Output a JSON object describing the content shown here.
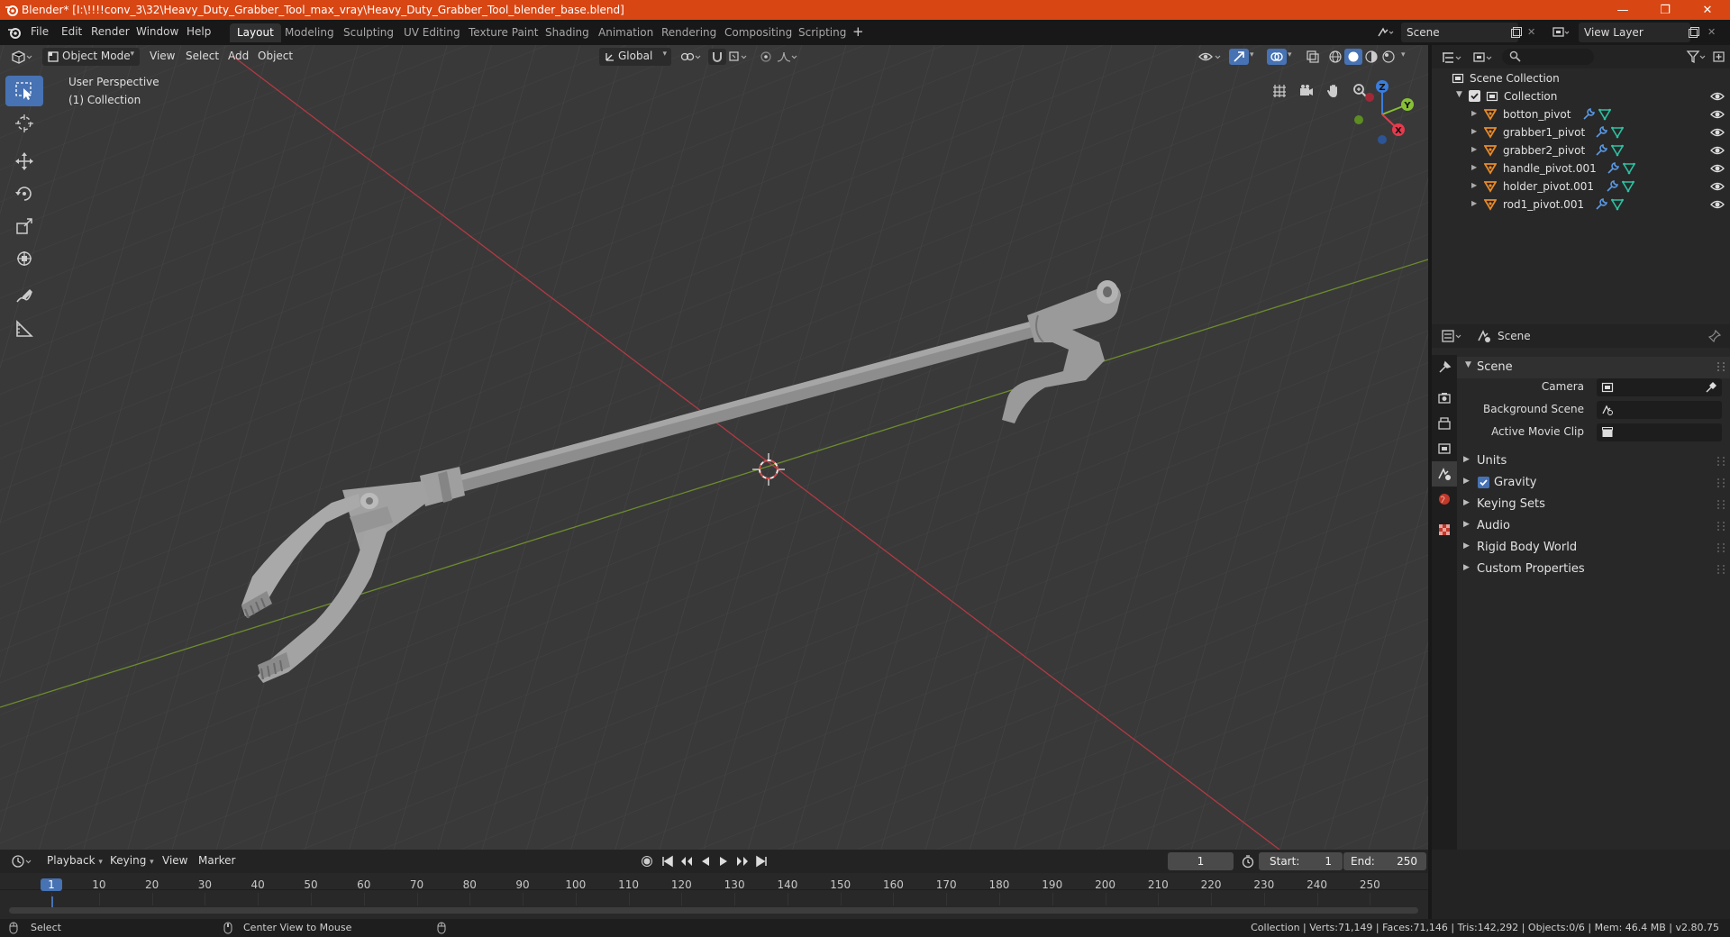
{
  "title_bar": {
    "title": "Blender* [I:\\!!!!conv_3\\32\\Heavy_Duty_Grabber_Tool_max_vray\\Heavy_Duty_Grabber_Tool_blender_base.blend]",
    "minimize": "—",
    "maximize": "❐",
    "close": "✕"
  },
  "menu": [
    "File",
    "Edit",
    "Render",
    "Window",
    "Help"
  ],
  "workspaces": [
    {
      "label": "Layout",
      "active": true
    },
    {
      "label": "Modeling",
      "active": false
    },
    {
      "label": "Sculpting",
      "active": false
    },
    {
      "label": "UV Editing",
      "active": false
    },
    {
      "label": "Texture Paint",
      "active": false
    },
    {
      "label": "Shading",
      "active": false
    },
    {
      "label": "Animation",
      "active": false
    },
    {
      "label": "Rendering",
      "active": false
    },
    {
      "label": "Compositing",
      "active": false
    },
    {
      "label": "Scripting",
      "active": false
    }
  ],
  "add_workspace": "+",
  "scene_field": "Scene",
  "view_layer_field": "View Layer",
  "viewport": {
    "mode": "Object Mode",
    "menus": [
      "View",
      "Select",
      "Add",
      "Object"
    ],
    "transform_orientation": "Global",
    "perspective_label": "User Perspective",
    "collection_label": "(1) Collection",
    "gizmo": {
      "x": "X",
      "y": "Y",
      "z": "Z"
    }
  },
  "outliner": {
    "root": "Scene Collection",
    "collection": "Collection",
    "objects": [
      "botton_pivot",
      "grabber1_pivot",
      "grabber2_pivot",
      "handle_pivot.001",
      "holder_pivot.001",
      "rod1_pivot.001"
    ]
  },
  "properties": {
    "header": "Scene",
    "section": "Scene",
    "fields": [
      {
        "label": "Camera"
      },
      {
        "label": "Background Scene"
      },
      {
        "label": "Active Movie Clip"
      }
    ],
    "panels": [
      {
        "label": "Units",
        "checkbox": false
      },
      {
        "label": "Gravity",
        "checkbox": true
      },
      {
        "label": "Keying Sets",
        "checkbox": false
      },
      {
        "label": "Audio",
        "checkbox": false
      },
      {
        "label": "Rigid Body World",
        "checkbox": false
      },
      {
        "label": "Custom Properties",
        "checkbox": false
      }
    ]
  },
  "timeline": {
    "menus": [
      "Playback",
      "Keying",
      "View",
      "Marker"
    ],
    "current_frame": "1",
    "start_label": "Start:",
    "start": "1",
    "end_label": "End:",
    "end": "250",
    "ticks": [
      "1",
      "10",
      "20",
      "30",
      "40",
      "50",
      "60",
      "70",
      "80",
      "90",
      "100",
      "110",
      "120",
      "130",
      "140",
      "150",
      "160",
      "170",
      "180",
      "190",
      "200",
      "210",
      "220",
      "230",
      "240",
      "250"
    ]
  },
  "status_bar": {
    "select": "Select",
    "center_view": "Center View to Mouse",
    "stats": "Collection | Verts:71,149 | Faces:71,146 | Tris:142,292 | Objects:0/6 | Mem: 46.4 MB | v2.80.75"
  },
  "colors": {
    "title_bar": "#d84614",
    "accent": "#4772b3",
    "x_axis": "#e8394d",
    "y_axis": "#86c033",
    "z_axis": "#3b7ddd",
    "object_icon": "#e88a2a",
    "mesh_icon": "#2cc2a3"
  }
}
